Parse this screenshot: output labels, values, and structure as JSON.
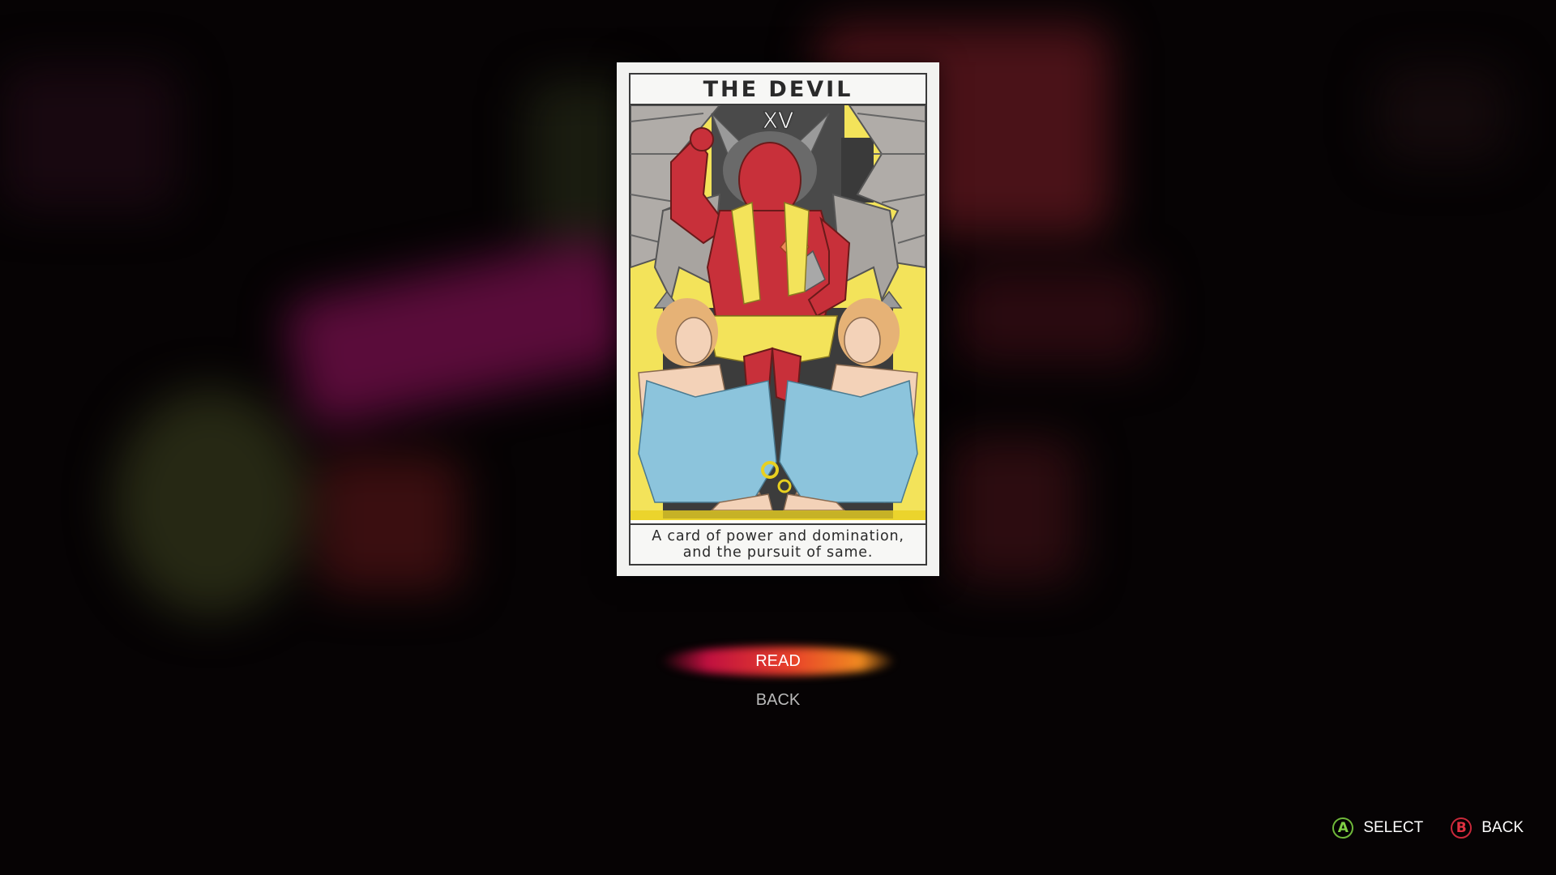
{
  "card": {
    "title": "THE DEVIL",
    "numeral": "XV",
    "caption_line1": "A card of power and domination,",
    "caption_line2": "and the pursuit of same.",
    "art": "devil-tarot-illustration"
  },
  "menu": {
    "items": [
      {
        "label": "READ",
        "selected": true
      },
      {
        "label": "BACK",
        "selected": false
      }
    ]
  },
  "hints": {
    "select": {
      "button": "A",
      "label": "SELECT",
      "color": "#7fcf44"
    },
    "back": {
      "button": "B",
      "label": "BACK",
      "color": "#e03040"
    }
  },
  "colors": {
    "highlight_start": "#c01040",
    "highlight_end": "#f08a20",
    "card_yellow": "#f3e35a",
    "devil_red": "#c8303a",
    "dress_blue": "#8cc4dc"
  }
}
